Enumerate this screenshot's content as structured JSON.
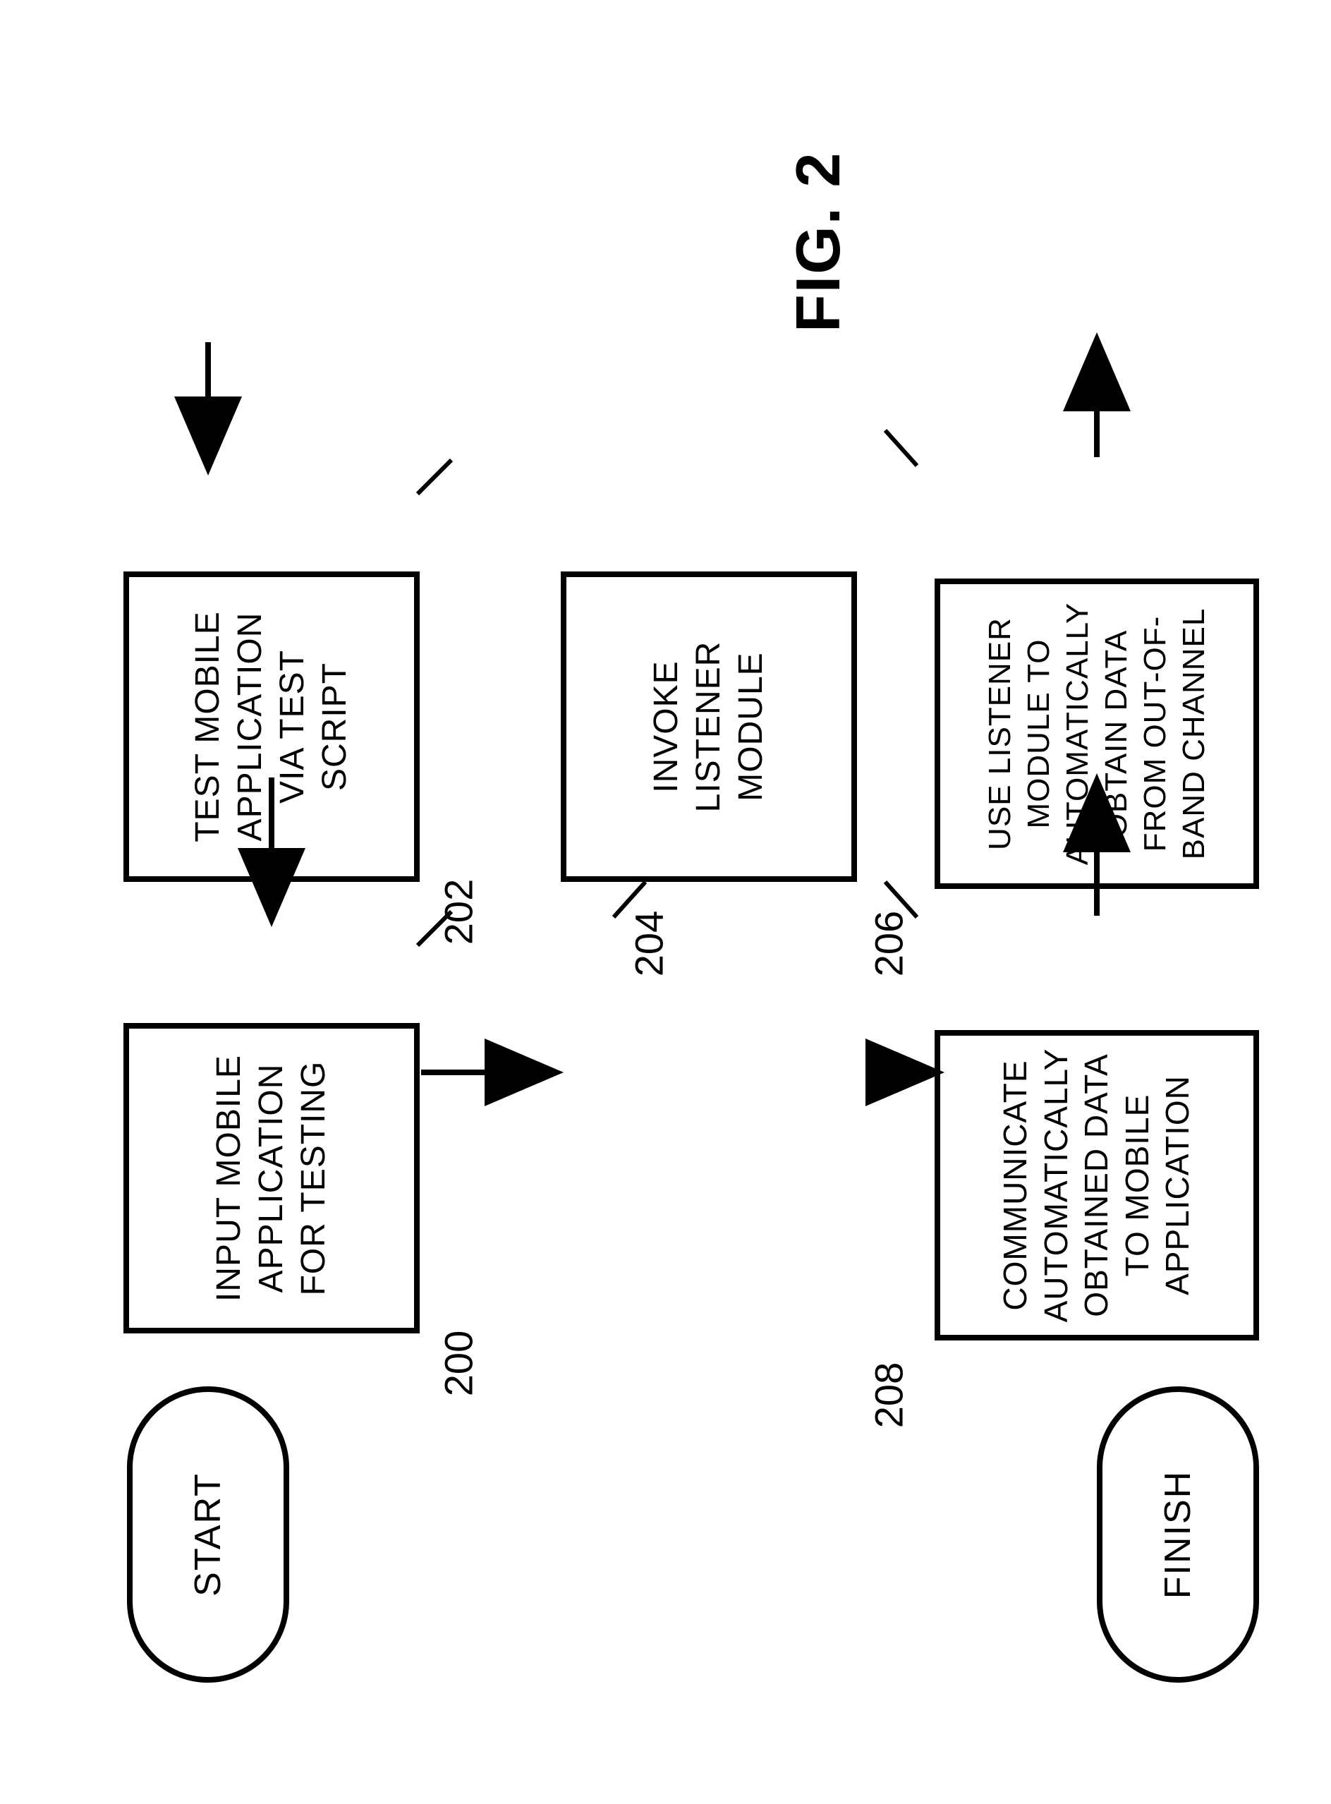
{
  "figure_label": "FIG. 2",
  "nodes": {
    "start": "START",
    "finish": "FINISH",
    "b200": "INPUT MOBILE APPLICATION FOR TESTING",
    "b202": "TEST MOBILE APPLICATION VIA TEST SCRIPT",
    "b204": "INVOKE LISTENER MODULE",
    "b206": "USE LISTENER MODULE TO AUTOMATICALLY OBTAIN DATA FROM OUT-OF-BAND CHANNEL",
    "b208": "COMMUNICATE AUTOMATICALLY OBTAINED DATA TO MOBILE APPLICATION"
  },
  "refs": {
    "r200": "200",
    "r202": "202",
    "r204": "204",
    "r206": "206",
    "r208": "208"
  }
}
